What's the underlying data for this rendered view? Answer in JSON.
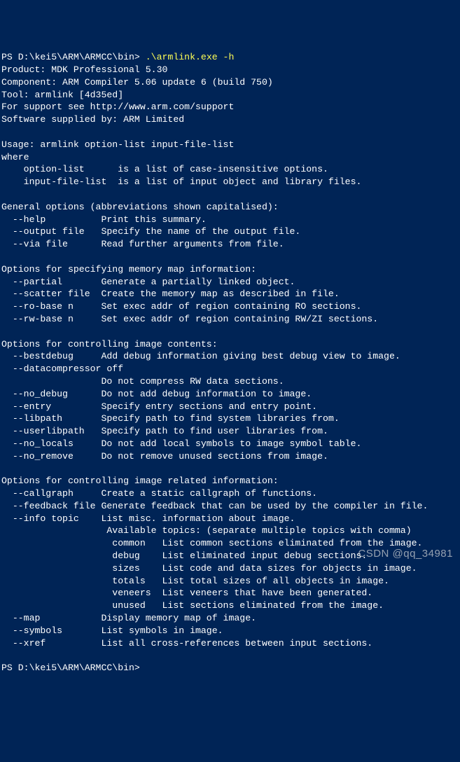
{
  "prompt1_path": "PS D:\\kei5\\ARM\\ARMCC\\bin> ",
  "prompt1_cmd": ".\\armlink.exe -h",
  "header": {
    "product": "Product: MDK Professional 5.30",
    "component": "Component: ARM Compiler 5.06 update 6 (build 750)",
    "tool": "Tool: armlink [4d35ed]",
    "support": "For support see http://www.arm.com/support",
    "supplied": "Software supplied by: ARM Limited"
  },
  "usage_line": "Usage: armlink option-list input-file-list",
  "where_line": "where",
  "opt_list_line": "    option-list      is a list of case-insensitive options.",
  "input_file_line": "    input-file-list  is a list of input object and library files.",
  "general_title": "General options (abbreviations shown capitalised):",
  "general": {
    "help": "  --help          Print this summary.",
    "output": "  --output file   Specify the name of the output file.",
    "via": "  --via file      Read further arguments from file."
  },
  "mem_title": "Options for specifying memory map information:",
  "mem": {
    "partial": "  --partial       Generate a partially linked object.",
    "scatter": "  --scatter file  Create the memory map as described in file.",
    "ro": "  --ro-base n     Set exec addr of region containing RO sections.",
    "rw": "  --rw-base n     Set exec addr of region containing RW/ZI sections."
  },
  "img_title": "Options for controlling image contents:",
  "img": {
    "bestdebug": "  --bestdebug     Add debug information giving best debug view to image.",
    "datacomp1": "  --datacompressor off",
    "datacomp2": "                  Do not compress RW data sections.",
    "no_debug": "  --no_debug      Do not add debug information to image.",
    "entry": "  --entry         Specify entry sections and entry point.",
    "libpath": "  --libpath       Specify path to find system libraries from.",
    "userlibpath": "  --userlibpath   Specify path to find user libraries from.",
    "no_locals": "  --no_locals     Do not add local symbols to image symbol table.",
    "no_remove": "  --no_remove     Do not remove unused sections from image."
  },
  "rel_title": "Options for controlling image related information:",
  "rel": {
    "callgraph": "  --callgraph     Create a static callgraph of functions.",
    "feedback": "  --feedback file Generate feedback that can be used by the compiler in file.",
    "info": "  --info topic    List misc. information about image.",
    "topics0": "                   Available topics: (separate multiple topics with comma)",
    "topics1": "                    common   List common sections eliminated from the image.",
    "topics2": "                    debug    List eliminated input debug sections.",
    "topics3": "                    sizes    List code and data sizes for objects in image.",
    "topics4": "                    totals   List total sizes of all objects in image.",
    "topics5": "                    veneers  List veneers that have been generated.",
    "topics6": "                    unused   List sections eliminated from the image.",
    "map": "  --map           Display memory map of image.",
    "symbols": "  --symbols       List symbols in image.",
    "xref": "  --xref          List all cross-references between input sections."
  },
  "prompt2_path": "PS D:\\kei5\\ARM\\ARMCC\\bin> ",
  "watermark": "CSDN @qq_34981"
}
